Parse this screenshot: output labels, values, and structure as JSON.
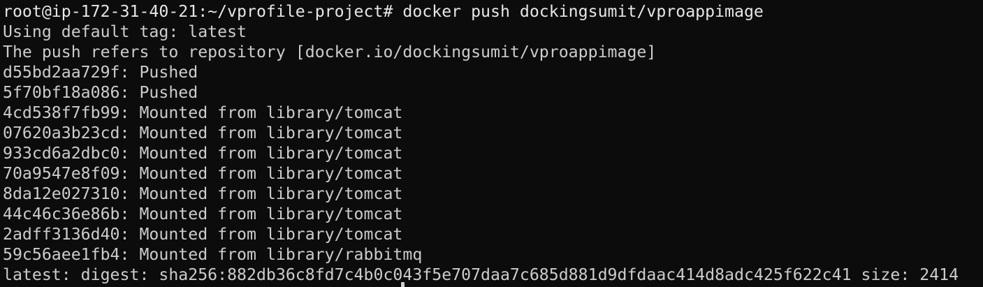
{
  "terminal": {
    "lines": [
      "root@ip-172-31-40-21:~/vprofile-project# docker push dockingsumit/vproappimage",
      "Using default tag: latest",
      "The push refers to repository [docker.io/dockingsumit/vproappimage]",
      "d55bd2aa729f: Pushed",
      "5f70bf18a086: Pushed",
      "4cd538f7fb99: Mounted from library/tomcat",
      "07620a3b23cd: Mounted from library/tomcat",
      "933cd6a2dbc0: Mounted from library/tomcat",
      "70a9547e8f09: Mounted from library/tomcat",
      "8da12e027310: Mounted from library/tomcat",
      "44c46c36e86b: Mounted from library/tomcat",
      "2adff3136d40: Mounted from library/tomcat",
      "59c56aee1fb4: Mounted from library/rabbitmq",
      "latest: digest: sha256:882db36c8fd7c4b0c043f5e707daa7c685d881d9dfdaac414d8adc425f622c41 size: 2414"
    ]
  }
}
